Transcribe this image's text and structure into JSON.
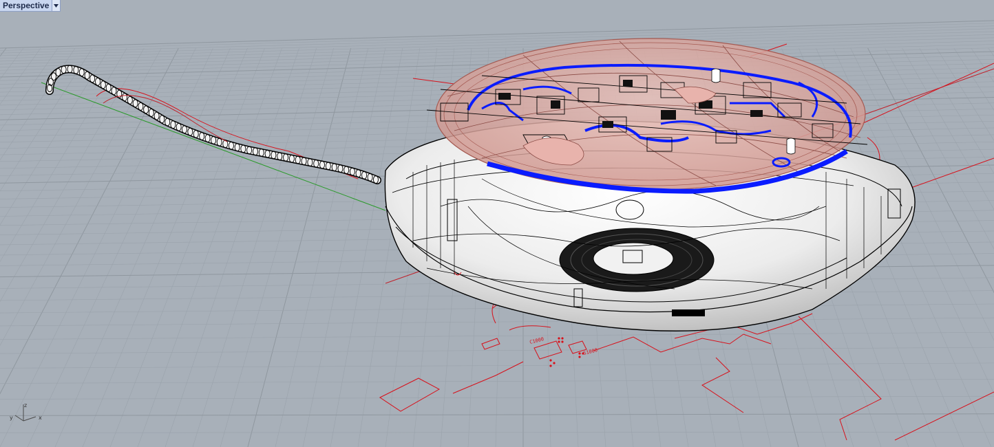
{
  "viewport": {
    "title": "Perspective",
    "menu_icon": "chevron-down-icon"
  },
  "axes": {
    "x_label": "x",
    "y_label": "y",
    "z_label": "z"
  },
  "colors": {
    "background": "#a8b0b9",
    "grid_line": "#9aa2ab",
    "grid_major": "#8f979f",
    "axis_x": "#c0202a",
    "axis_y": "#2a9a2a",
    "wireframe": "#000000",
    "lid_fill": "#d9a7a0",
    "highlight_blue": "#0a1cff",
    "body_fill": "#f2f2f2",
    "pcb_outline": "#d8101a"
  },
  "pcb_labels": [
    "C1000",
    "S1000"
  ]
}
